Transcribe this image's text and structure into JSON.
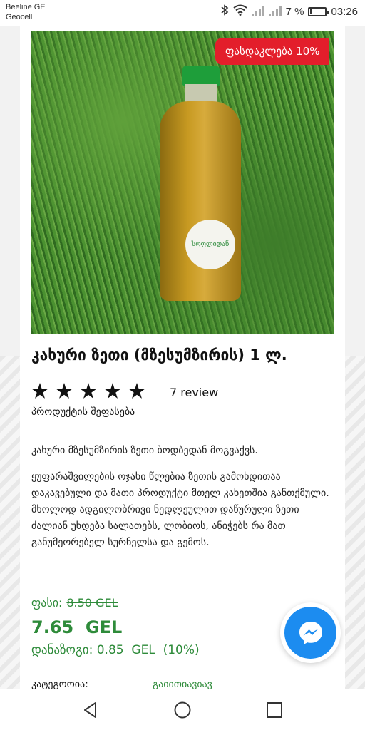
{
  "status_bar": {
    "carrier_1": "Beeline GE",
    "carrier_2": "Geocell",
    "battery_percent": "7 %",
    "battery_level": 0.07,
    "time": "03:26",
    "icons": [
      "bluetooth-icon",
      "wifi-icon",
      "signal-icon",
      "signal-icon",
      "battery-icon"
    ]
  },
  "product": {
    "discount_badge": "ფასდაკლება 10%",
    "image_label": "სოფლიდან",
    "title": "კახური ზეთი (მზესუმზირის) 1 ლ.",
    "rating_stars": 5,
    "reviews": "7 review",
    "rate_link": "პროდუქტის შეფასება",
    "description_1": "კახური მზესუმზირის ზეთი ბოდბედან მოგვაქვს.",
    "description_2": "ყუფარაშვილების ოჯახი წლებია ზეთის გამოხდითაა დაკავებული და მათი პროდუქტი მთელ კახეთშია განთქმული. მხოლოდ ადგილობრივი ნედლეულით დაწურული ზეთი ძალიან უხდება სალათებს, ლობიოს, ანიჭებს რა მათ განუმეორებელ სურნელსა და გემოს.",
    "price_label": "ფასი:",
    "old_price": "8.50  GEL",
    "new_price": "7.65  GEL",
    "savings": "დანაზოგი: 0.85  GEL  (10%)",
    "category_label": "კატეგორია:",
    "category_value": "გაიითიავზავ"
  },
  "colors": {
    "accent_green": "#2e8b3a",
    "badge_red": "#e31e2b",
    "messenger_blue": "#1c8cf0"
  },
  "nav": {
    "icons": [
      "back-icon",
      "home-icon",
      "recent-apps-icon"
    ]
  }
}
